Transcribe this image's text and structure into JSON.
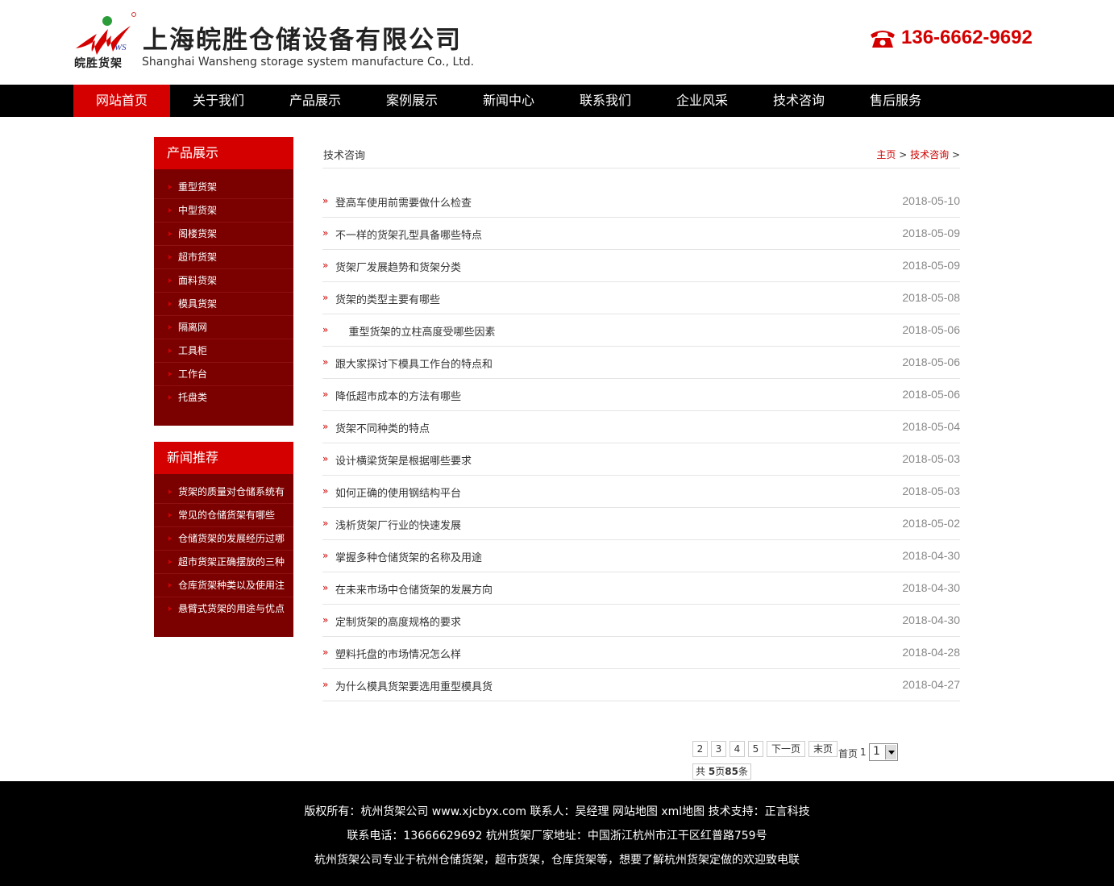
{
  "header": {
    "logo_text": "皖胜货架",
    "company_name": "上海皖胜仓储设备有限公司",
    "company_name_en": "Shanghai Wansheng storage system manufacture Co., Ltd.",
    "phone_icon": "phone-icon",
    "phone": "136-6662-9692"
  },
  "nav": {
    "items": [
      "网站首页",
      "关于我们",
      "产品展示",
      "案例展示",
      "新闻中心",
      "联系我们",
      "企业风采",
      "技术咨询",
      "售后服务"
    ],
    "active": "网站首页"
  },
  "sidebar": {
    "products_title": "产品展示",
    "products": [
      "重型货架",
      "中型货架",
      "阁楼货架",
      "超市货架",
      "面料货架",
      "模具货架",
      "隔离网",
      "工具柜",
      "工作台",
      "托盘类"
    ],
    "news_title": "新闻推荐",
    "news": [
      "货架的质量对仓储系统有",
      "常见的仓储货架有哪些",
      "仓储货架的发展经历过哪",
      "超市货架正确摆放的三种",
      "仓库货架种类以及使用注",
      "悬臂式货架的用途与优点"
    ]
  },
  "main": {
    "title": "技术咨询",
    "breadcrumb": {
      "home": "主页",
      "sep1": ">",
      "current": "技术咨询",
      "sep2": ">"
    },
    "articles": [
      {
        "title": "登高车使用前需要做什么检查",
        "date": "2018-05-10"
      },
      {
        "title": "不一样的货架孔型具备哪些特点",
        "date": "2018-05-09"
      },
      {
        "title": "货架厂发展趋势和货架分类",
        "date": "2018-05-09"
      },
      {
        "title": "货架的类型主要有哪些",
        "date": "2018-05-08"
      },
      {
        "title": "    重型货架的立柱高度受哪些因素",
        "date": "2018-05-06"
      },
      {
        "title": "跟大家探讨下模具工作台的特点和",
        "date": "2018-05-06"
      },
      {
        "title": "降低超市成本的方法有哪些",
        "date": "2018-05-06"
      },
      {
        "title": "货架不同种类的特点",
        "date": "2018-05-04"
      },
      {
        "title": "设计横梁货架是根据哪些要求",
        "date": "2018-05-03"
      },
      {
        "title": "如何正确的使用钢结构平台",
        "date": "2018-05-03"
      },
      {
        "title": "浅析货架厂行业的快速发展",
        "date": "2018-05-02"
      },
      {
        "title": "掌握多种仓储货架的名称及用途",
        "date": "2018-04-30"
      },
      {
        "title": "在未来市场中仓储货架的发展方向",
        "date": "2018-04-30"
      },
      {
        "title": "定制货架的高度规格的要求",
        "date": "2018-04-30"
      },
      {
        "title": "塑料托盘的市场情况怎么样",
        "date": "2018-04-28"
      },
      {
        "title": "为什么模具货架要选用重型模具货",
        "date": "2018-04-27"
      }
    ]
  },
  "pagination": {
    "pages": [
      "2",
      "3",
      "4",
      "5"
    ],
    "next": "下一页",
    "last": "末页",
    "first": "首页",
    "current": "1",
    "select_value": "1",
    "total_prefix": "共 ",
    "total_pages": "5",
    "pages_unit": "页",
    "total_items": "85",
    "items_unit": "条"
  },
  "footer": {
    "line1": "版权所有：杭州货架公司 www.xjcbyx.com 联系人：吴经理 网站地图 xml地图 技术支持：正言科技",
    "line2": "联系电话：13666629692 杭州货架厂家地址：中国浙江杭州市江干区红普路759号",
    "line3": "杭州货架公司专业于杭州仓储货架，超市货架，仓库货架等，想要了解杭州货架定做的欢迎致电联"
  },
  "colors": {
    "accent": "#d40000",
    "sidebar_bg": "#7b0000",
    "nav_bg": "#000000"
  }
}
